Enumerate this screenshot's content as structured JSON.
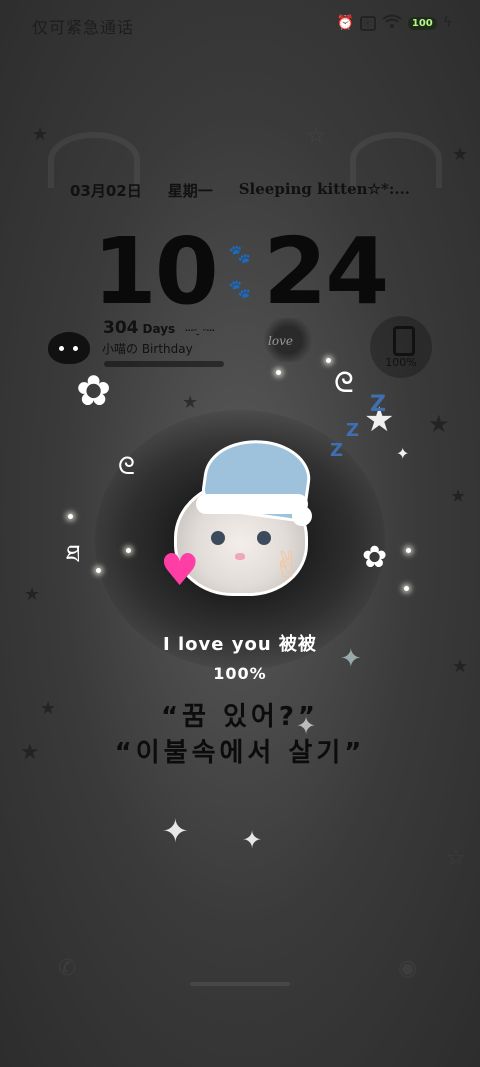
{
  "status_bar": {
    "carrier_text": "仅可紧急通话",
    "battery_level": "100",
    "icons": [
      "alarm-icon",
      "sim-icon",
      "wifi-icon",
      "battery-icon",
      "charging-icon"
    ]
  },
  "date_row": {
    "date": "03月02日",
    "weekday": "星期一",
    "caption": "Sleeping kitten☆*:..."
  },
  "clock": {
    "hours": "10",
    "minutes": "24"
  },
  "days_widget": {
    "count": "304",
    "unit": "Days",
    "decoration": "⋯ᵕ ̫ ᵕ⋯",
    "label": "小喵の Birthday"
  },
  "love_widget": {
    "text": "love"
  },
  "battery_widget": {
    "percent": "100%"
  },
  "main_text": {
    "love_line": "I love you 被被",
    "percent": "100%",
    "korean_line1": "“꿈 있어?”",
    "korean_line2": "“이불속에서 살기”"
  },
  "colors": {
    "background": "#262626",
    "heart": "#ff3ea5",
    "hat": "#9fc2dc",
    "zz": "#3f6fb0"
  }
}
